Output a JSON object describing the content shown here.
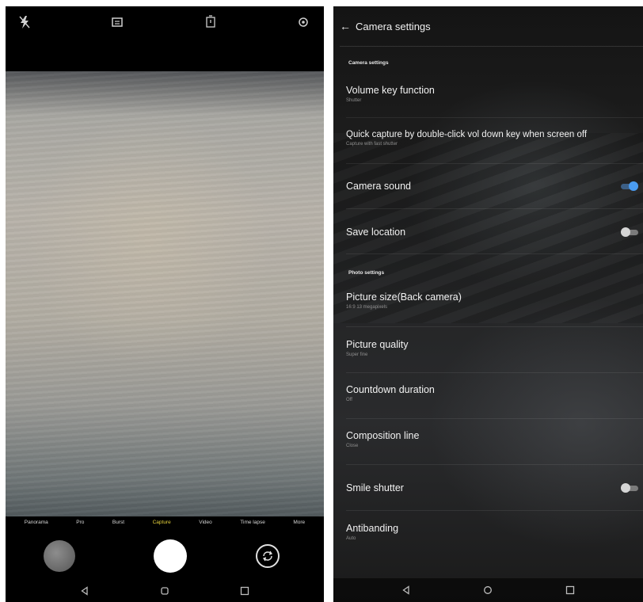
{
  "camera": {
    "top_icons": [
      "flash-off-icon",
      "aspect-ratio-icon",
      "timer-icon",
      "settings-icon"
    ],
    "modes": [
      "Panorama",
      "Pro",
      "Burst",
      "Capture",
      "Video",
      "Time lapse",
      "More"
    ],
    "active_mode": "Capture",
    "nav_icons": [
      "back-icon",
      "home-icon",
      "recents-icon"
    ]
  },
  "settings": {
    "title": "Camera settings",
    "sections": [
      {
        "header": "Camera settings",
        "items": [
          {
            "title": "Volume key function",
            "subtitle": "Shutter"
          },
          {
            "title": "Quick capture by double-click vol down key when screen off",
            "subtitle": "Capture with fast shutter"
          },
          {
            "title": "Camera sound",
            "toggle": true
          },
          {
            "title": "Save location",
            "toggle": false
          }
        ]
      },
      {
        "header": "Photo settings",
        "items": [
          {
            "title": "Picture size(Back camera)",
            "subtitle": "16:9 13 megapixels"
          },
          {
            "title": "Picture quality",
            "subtitle": "Super fine"
          },
          {
            "title": "Countdown duration",
            "subtitle": "Off"
          },
          {
            "title": "Composition line",
            "subtitle": "Close"
          },
          {
            "title": "Smile shutter",
            "toggle": false
          },
          {
            "title": "Antibanding",
            "subtitle": "Auto"
          }
        ]
      }
    ]
  },
  "colors": {
    "accent": "#4a9bf0",
    "active_mode": "#e6d23c"
  }
}
